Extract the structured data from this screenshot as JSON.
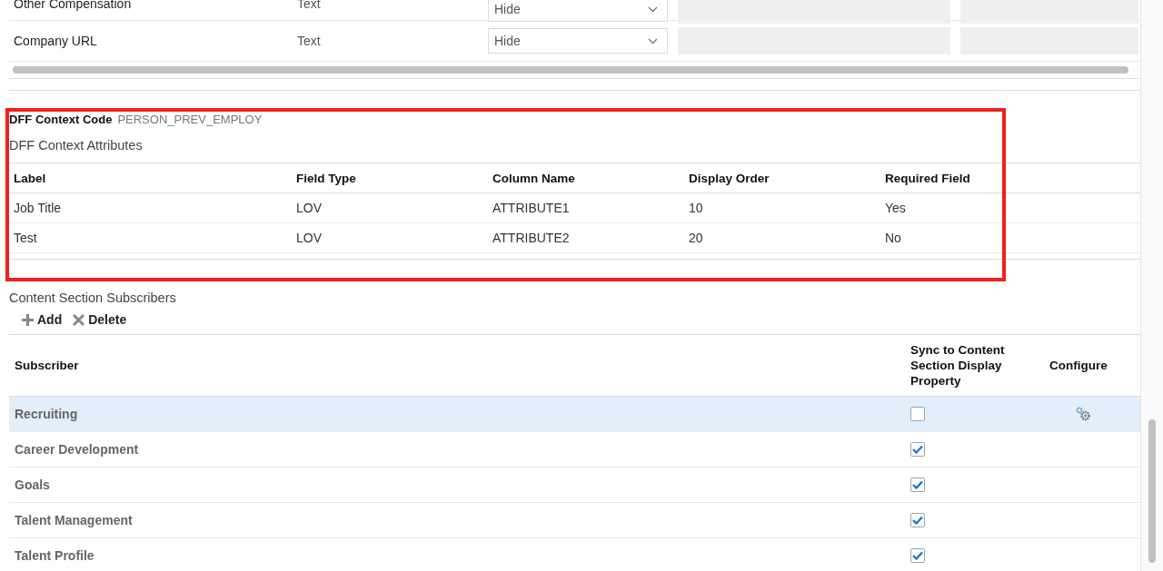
{
  "field_rows": [
    {
      "label": "Other Compensation",
      "type": "Text",
      "display": "Hide"
    },
    {
      "label": "Company URL",
      "type": "Text",
      "display": "Hide"
    }
  ],
  "dff": {
    "context_code_label": "DFF Context Code",
    "context_code": "PERSON_PREV_EMPLOY",
    "attributes_title": "DFF Context Attributes",
    "columns": [
      "Label",
      "Field Type",
      "Column Name",
      "Display Order",
      "Required Field"
    ],
    "rows": [
      [
        "Job Title",
        "LOV",
        "ATTRIBUTE1",
        "10",
        "Yes"
      ],
      [
        "Test",
        "LOV",
        "ATTRIBUTE2",
        "20",
        "No"
      ]
    ]
  },
  "subscribers": {
    "title": "Content Section Subscribers",
    "toolbar": [
      {
        "kind": "add",
        "label": "Add"
      },
      {
        "kind": "delete",
        "label": "Delete"
      }
    ],
    "columns": [
      "Subscriber",
      "Sync to Content Section Display Property",
      "Configure"
    ],
    "rows": [
      {
        "name": "Recruiting",
        "synced": false,
        "selected": true
      },
      {
        "name": "Career Development",
        "synced": true,
        "selected": false
      },
      {
        "name": "Goals",
        "synced": true,
        "selected": false
      },
      {
        "name": "Talent Management",
        "synced": true,
        "selected": false
      },
      {
        "name": "Talent Profile",
        "synced": true,
        "selected": false
      }
    ]
  }
}
